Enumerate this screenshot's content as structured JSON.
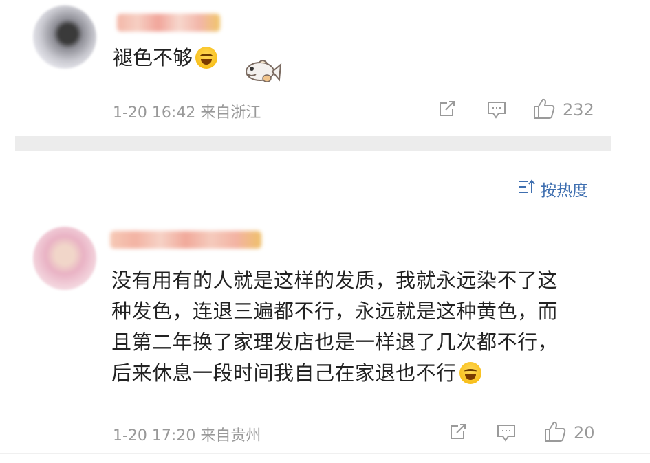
{
  "comments": [
    {
      "text": "褪色不够",
      "emoji": "laughing-crying-emoji",
      "sticker": "fish-sticker",
      "time": "1-20 16:42",
      "location": "来自浙江",
      "likes": "232"
    },
    {
      "text_lines": [
        "没有用有的人就是这样的发质，我就永远染不了这",
        "种发色，连退三遍都不行，永远就是这种黄色，而",
        "且第二年换了家理发店也是一样退了几次都不行，",
        "后来休息一段时间我自己在家退也不行"
      ],
      "emoji": "laughing-crying-emoji",
      "time": "1-20 17:20",
      "location": "来自贵州",
      "likes": "20"
    }
  ],
  "sort": {
    "label": "按热度",
    "icon": "sort-icon"
  },
  "icons": [
    "share-icon",
    "comment-icon",
    "like-icon"
  ],
  "colors": {
    "accent": "#3f6fb0",
    "meta": "#999999",
    "divider": "#ececec"
  }
}
